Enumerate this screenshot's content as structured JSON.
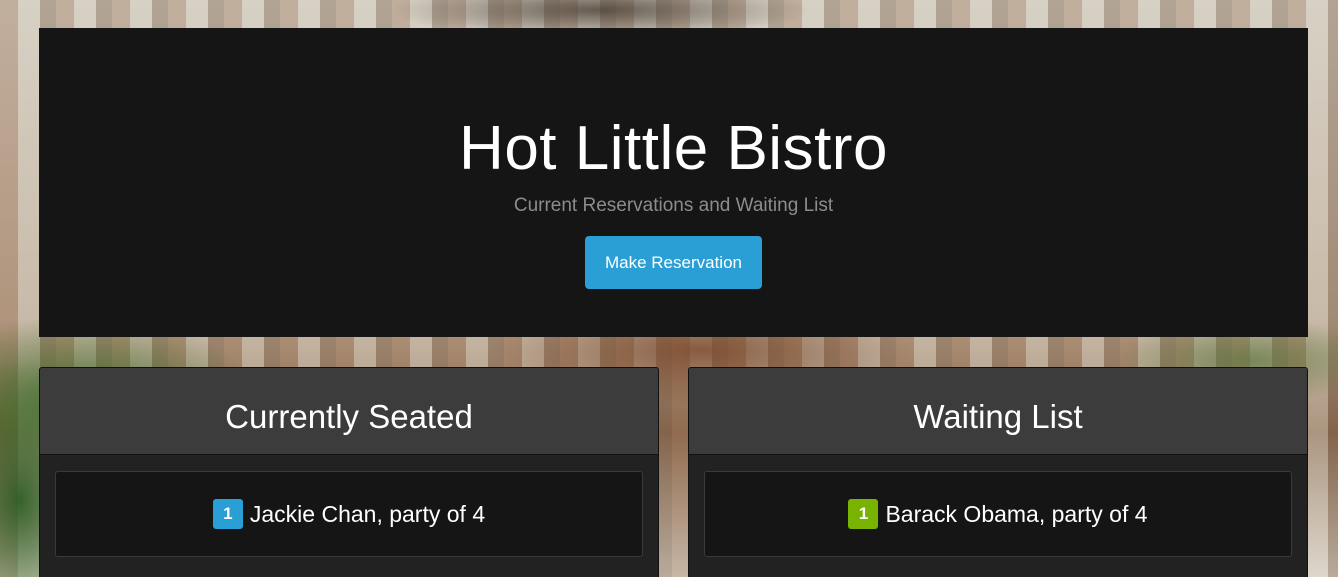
{
  "header": {
    "title": "Hot Little Bistro",
    "subtitle": "Current Reservations and Waiting List",
    "reserve_button_label": "Make Reservation"
  },
  "seated": {
    "heading": "Currently Seated",
    "items": [
      {
        "number": "1",
        "text": "Jackie Chan, party of 4"
      }
    ]
  },
  "waiting": {
    "heading": "Waiting List",
    "items": [
      {
        "number": "1",
        "text": "Barack Obama, party of 4"
      }
    ]
  },
  "colors": {
    "primary": "#2a9fd6",
    "success": "#77b300",
    "jumbotron_bg": "#151515",
    "panel_heading_bg": "#3c3c3c"
  }
}
